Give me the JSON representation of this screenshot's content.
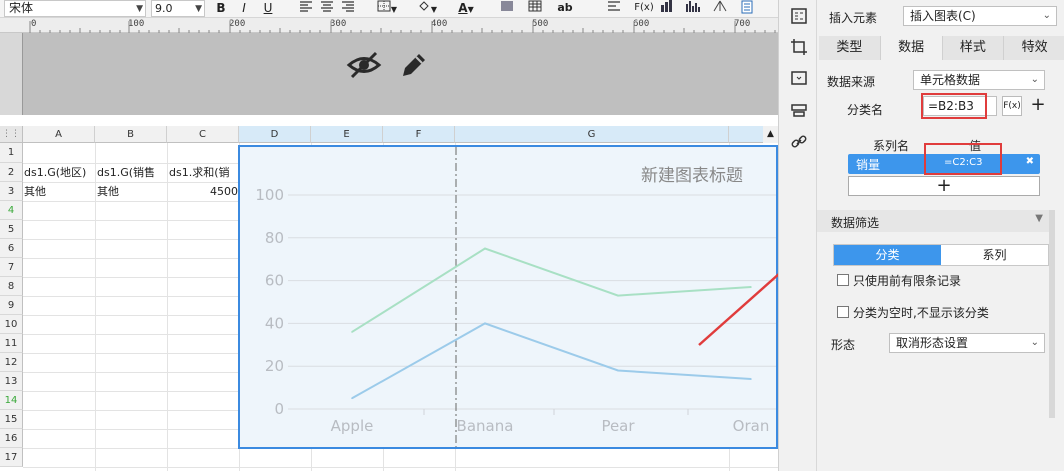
{
  "toolbar": {
    "font_name": "宋体",
    "font_size": "9.0",
    "bold": "B",
    "italic": "I",
    "font_color": "A",
    "text_btn": "ab",
    "formula_btn": "F(x)"
  },
  "ruler": {
    "ticks": [
      "0",
      "100",
      "200",
      "300",
      "400",
      "500",
      "600",
      "700"
    ]
  },
  "sheet": {
    "columns": [
      "A",
      "B",
      "C",
      "D",
      "E",
      "F",
      "G"
    ],
    "rows": [
      "1",
      "2",
      "3",
      "4",
      "5",
      "6",
      "7",
      "8",
      "9",
      "10",
      "11",
      "12",
      "13",
      "14",
      "15",
      "16",
      "17"
    ],
    "cells": {
      "a2": "ds1.G(地区)",
      "b2": "ds1.G(销售",
      "c2": "ds1.求和(销",
      "a3": "其他",
      "b3": "其他",
      "c3": "4500"
    }
  },
  "chart_data": {
    "type": "line",
    "title": "新建图表标题",
    "categories": [
      "Apple",
      "Banana",
      "Pear",
      "Oran"
    ],
    "ylim": [
      0,
      100
    ],
    "yticks": [
      "0",
      "20",
      "40",
      "60",
      "80",
      "100"
    ],
    "grid": true,
    "series": [
      {
        "name": "",
        "color": "#a8e0c4",
        "values": [
          36,
          75,
          53,
          57
        ]
      },
      {
        "name": "",
        "color": "#9ccbea",
        "values": [
          5,
          40,
          18,
          14
        ]
      }
    ]
  },
  "panel": {
    "insert_label": "插入元素",
    "insert_value": "插入图表(C)",
    "tabs": [
      "类型",
      "数据",
      "样式",
      "特效"
    ],
    "source_label": "数据来源",
    "source_value": "单元格数据",
    "category_label": "分类名",
    "category_value": "=B2:B3",
    "fx_label": "F(x)",
    "series_col_label": "系列名",
    "value_col_label": "值",
    "series_name": "销量",
    "series_value": "=C2:C3",
    "filter_title": "数据筛选",
    "seg_category": "分类",
    "seg_series": "系列",
    "chk_limited": "只使用前有限条记录",
    "chk_empty": "分类为空时,不显示该分类",
    "shape_label": "形态",
    "shape_value": "取消形态设置"
  },
  "colors": {
    "accent": "#3d96ec",
    "highlight_red": "#e03c3c",
    "chart_border": "#3b8ae0"
  }
}
